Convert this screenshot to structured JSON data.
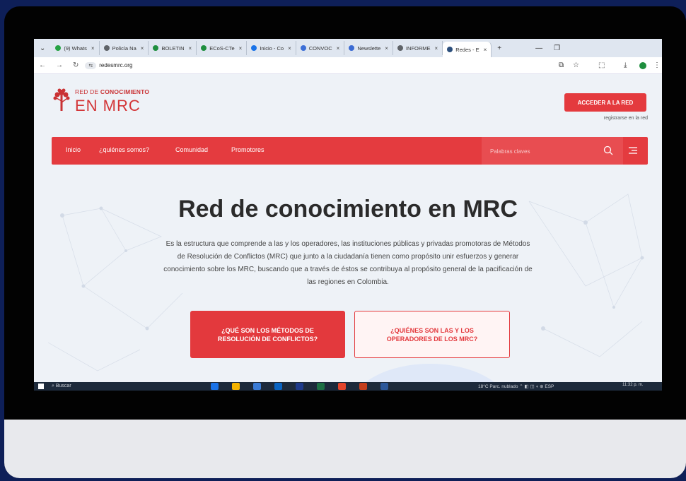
{
  "browser": {
    "tabs": [
      {
        "label": "(9) Whats",
        "color": "#25a243"
      },
      {
        "label": "Policía Na",
        "color": "#5f6368"
      },
      {
        "label": "BOLETIN",
        "color": "#1e8e3e"
      },
      {
        "label": "ECoS-CTe",
        "color": "#1e8e3e"
      },
      {
        "label": "Inicio - Co",
        "color": "#1a73e8"
      },
      {
        "label": "CONVOC",
        "color": "#3d6fd6"
      },
      {
        "label": "Newslette",
        "color": "#3b6bd3"
      },
      {
        "label": "INFORME",
        "color": "#5f6368"
      },
      {
        "label": "Redes - E",
        "color": "#2c4f7c",
        "active": true
      }
    ],
    "new_tab": "+",
    "url": "redesmrc.org",
    "url_badge": "⇆"
  },
  "site": {
    "logo_line1_prefix": "RED DE ",
    "logo_line1_bold": "CONOCIMIENTO",
    "logo_line2": "EN MRC",
    "cta_label": "ACCEDER A LA RED",
    "cta_sub": "registrarse en la red",
    "nav": [
      "Inicio",
      "¿quiénes somos?",
      "Comunidad",
      "Promotores"
    ],
    "search_placeholder": "Palabras claves"
  },
  "hero": {
    "title": "Red de conocimiento en MRC",
    "text": "Es la estructura que comprende a las y los operadores, las instituciones públicas y privadas promotoras de Métodos de Resolución de Conflictos (MRC) que junto a la ciudadanía tienen como propósito unir esfuerzos y generar conocimiento sobre los MRC, buscando que a través de éstos se contribuya al propósito general de la pacificación de las regiones en Colombia.",
    "button1": "¿QUÉ SON LOS MÉTODOS DE RESOLUCIÓN DE CONFLICTOS?",
    "button2": "¿QUIÉNES SON LAS Y LOS OPERADORES DE LOS MRC?"
  },
  "taskbar": {
    "search": "Buscar",
    "weather": "18°C  Parc. nublado",
    "lang": "ESP",
    "time": "11:32 p. m."
  },
  "colors": {
    "accent": "#e43b3f",
    "frame": "#020202",
    "background": "#0e1f58"
  }
}
